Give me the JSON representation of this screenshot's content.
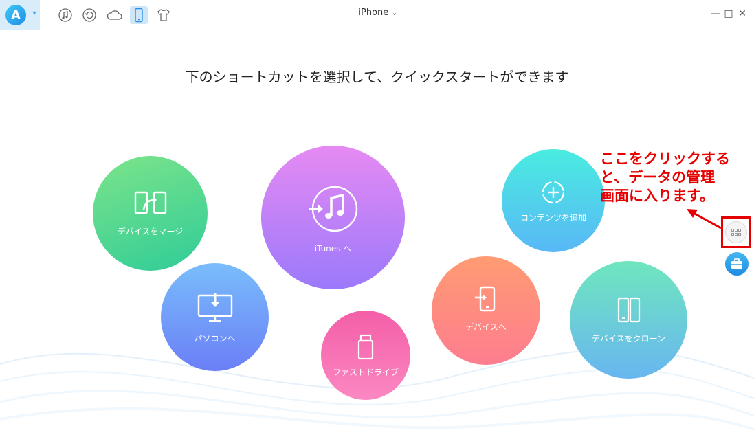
{
  "window": {
    "title": "iPhone",
    "title_chevron": "⌄"
  },
  "toolbar": {
    "icons": [
      "music-icon",
      "restore-icon",
      "cloud-icon",
      "phone-icon",
      "shirt-icon"
    ],
    "active": "phone-icon",
    "logo_letter": "A",
    "logo_menu_glyph": "▾"
  },
  "window_controls": {
    "minimize": "—",
    "maximize": "□",
    "close": "✕"
  },
  "headline": "下のショートカットを選択して、クイックスタートができます",
  "shortcuts": {
    "merge": "デバイスをマージ",
    "itunes": "iTunes へ",
    "add_content": "コンテンツを追加",
    "to_pc": "パソコンへ",
    "flash_drive": "ファストドライブ",
    "to_device": "デバイスへ",
    "clone": "デバイスをクローン"
  },
  "annotation": {
    "line1": "ここをクリックする",
    "line2": "と、データの管理",
    "line3": "画面に入ります。"
  },
  "colors": {
    "accent": "#1f8de6",
    "annotation": "#e60000"
  }
}
